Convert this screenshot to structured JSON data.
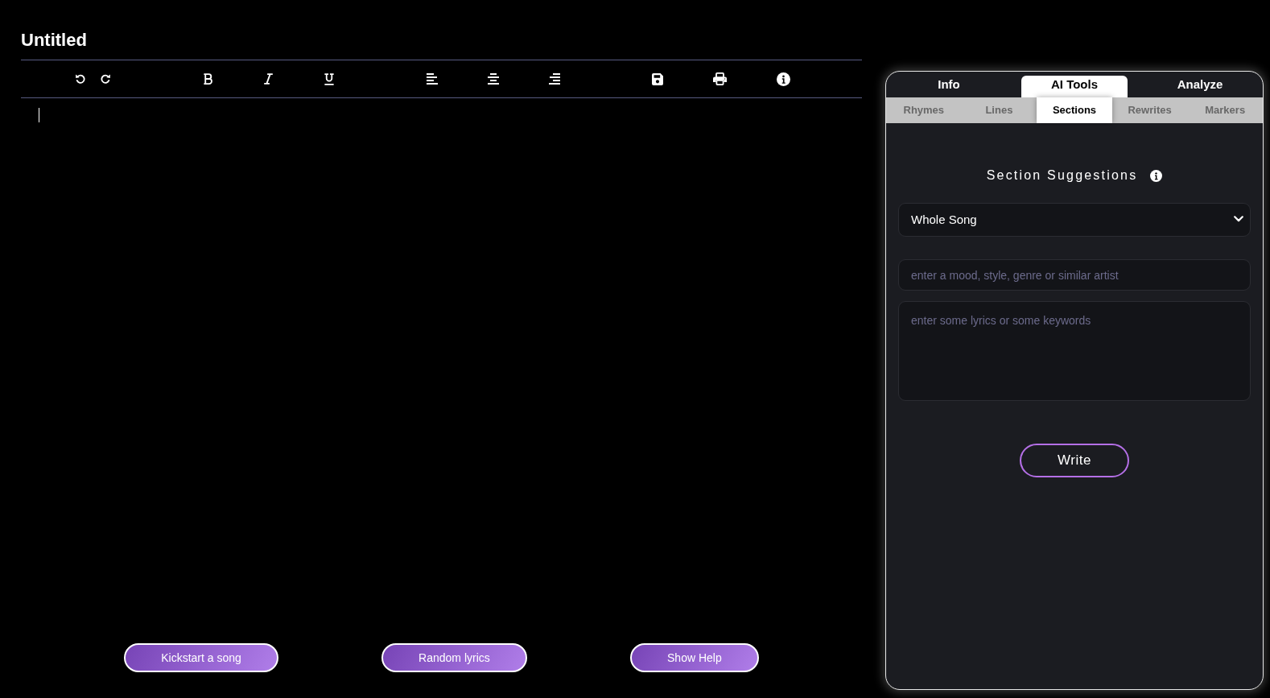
{
  "document": {
    "title": "Untitled"
  },
  "editor": {
    "focused": true
  },
  "actions": [
    "Kickstart a song",
    "Random lyrics",
    "Show Help"
  ],
  "panel": {
    "tabs": [
      {
        "label": "Info",
        "selected": false
      },
      {
        "label": "AI Tools",
        "selected": true
      },
      {
        "label": "Analyze",
        "selected": false
      }
    ],
    "subtabs": [
      {
        "label": "Rhymes",
        "selected": false
      },
      {
        "label": "Lines",
        "selected": false
      },
      {
        "label": "Sections",
        "selected": true
      },
      {
        "label": "Rewrites",
        "selected": false
      },
      {
        "label": "Markers",
        "selected": false
      }
    ],
    "heading": "Section Suggestions",
    "section_select": {
      "value": "Whole Song"
    },
    "style_field": {
      "placeholder": "enter a mood, style, genre or similar artist"
    },
    "lyrics_field": {
      "placeholder": "enter some lyrics or some keywords"
    },
    "submit_button": "Write"
  }
}
